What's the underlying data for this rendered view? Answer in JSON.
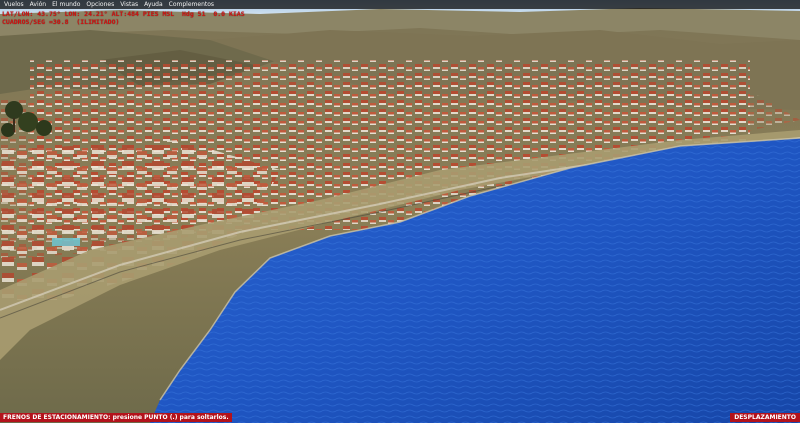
{
  "menu": {
    "items": [
      "Vuelos",
      "Avión",
      "El mundo",
      "Opciones",
      "Vistas",
      "Ayuda",
      "Complementos"
    ]
  },
  "hud": {
    "line1": "LAT/LON: 43.75° LON: 24.21° ALT:484 PIES MSL  Hdg 51  0.0 KIAS",
    "line2": "CUADROS/SEG =30.8  (ILIMITADO)"
  },
  "status": {
    "left": "FRENOS DE ESTACIONAMIENTO: presione PUNTO (.) para soltarlos.",
    "right": "DESPLAZAMIENTO"
  },
  "colors": {
    "sea": "#1d52c4",
    "terrain": "#8a7a4e",
    "roofs": "#b94a32",
    "status_bar": "#b3121b",
    "hud_text": "#d40f0f"
  }
}
